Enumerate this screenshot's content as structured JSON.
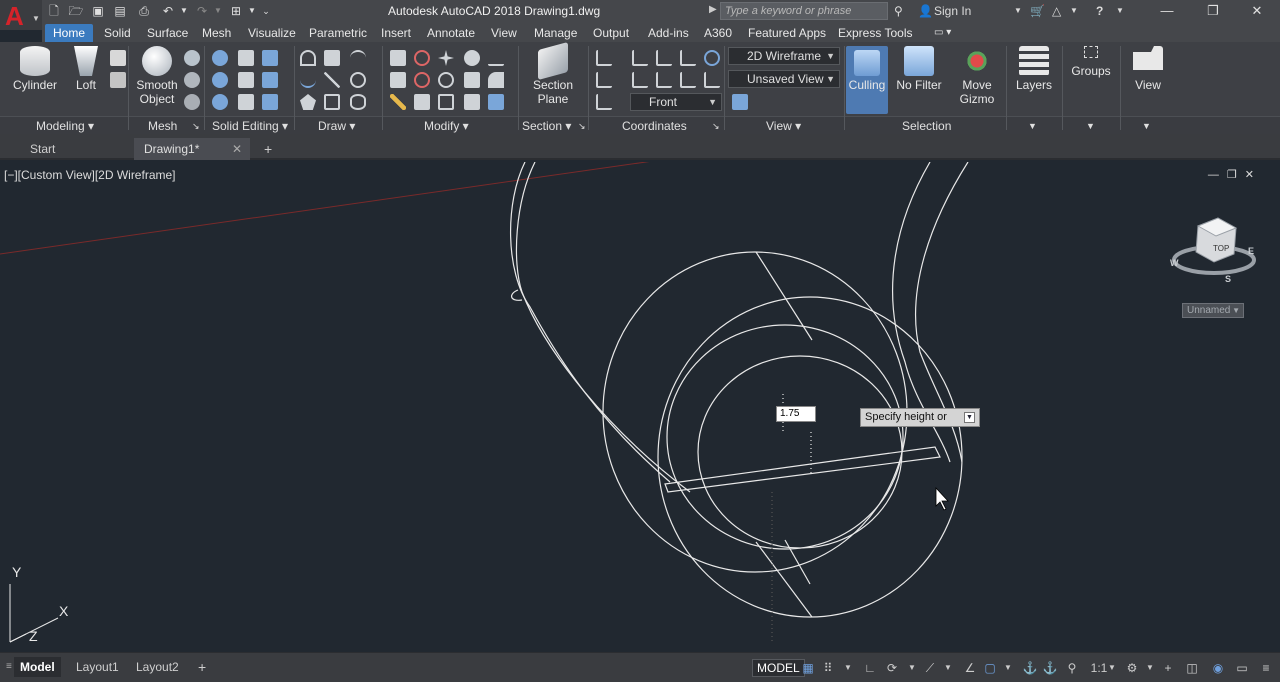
{
  "titlebar": {
    "title": "Autodesk AutoCAD 2018    Drawing1.dwg",
    "search_placeholder": "Type a keyword or phrase",
    "sign_in": "Sign In"
  },
  "ribbon_tabs": [
    "Home",
    "Solid",
    "Surface",
    "Mesh",
    "Visualize",
    "Parametric",
    "Insert",
    "Annotate",
    "View",
    "Manage",
    "Output",
    "Add-ins",
    "A360",
    "Featured Apps",
    "Express Tools"
  ],
  "ribbon": {
    "modeling": {
      "cylinder": "Cylinder",
      "loft": "Loft",
      "label": "Modeling"
    },
    "mesh": {
      "smooth_object": "Smooth\nObject",
      "label": "Mesh"
    },
    "solid_editing": {
      "label": "Solid Editing"
    },
    "draw": {
      "label": "Draw"
    },
    "modify": {
      "label": "Modify"
    },
    "section": {
      "section_plane": "Section\nPlane",
      "label": "Section"
    },
    "coordinates": {
      "label": "Coordinates",
      "front": "Front"
    },
    "view": {
      "visual_style": "2D Wireframe",
      "saved_view": "Unsaved View",
      "label": "View"
    },
    "selection": {
      "culling": "Culling",
      "no_filter": "No Filter",
      "move_gizmo": "Move\nGizmo",
      "label": "Selection"
    },
    "layers": {
      "label": "Layers"
    },
    "groups": {
      "label": "Groups"
    },
    "view_btn": {
      "label": "View"
    }
  },
  "file_tabs": {
    "start": "Start",
    "drawing": "Drawing1*"
  },
  "viewport": {
    "label": "[−][Custom View][2D Wireframe]",
    "dynamic_input_value": "1.75",
    "tooltip": "Specify height or",
    "viewcube": {
      "face": "TOP",
      "w": "W",
      "s": "S",
      "e": "E"
    },
    "unnamed": "Unnamed",
    "ucs": {
      "x": "X",
      "y": "Y",
      "z": "Z"
    }
  },
  "layout_tabs": [
    "Model",
    "Layout1",
    "Layout2"
  ],
  "status": {
    "model": "MODEL",
    "scale": "1:1"
  }
}
